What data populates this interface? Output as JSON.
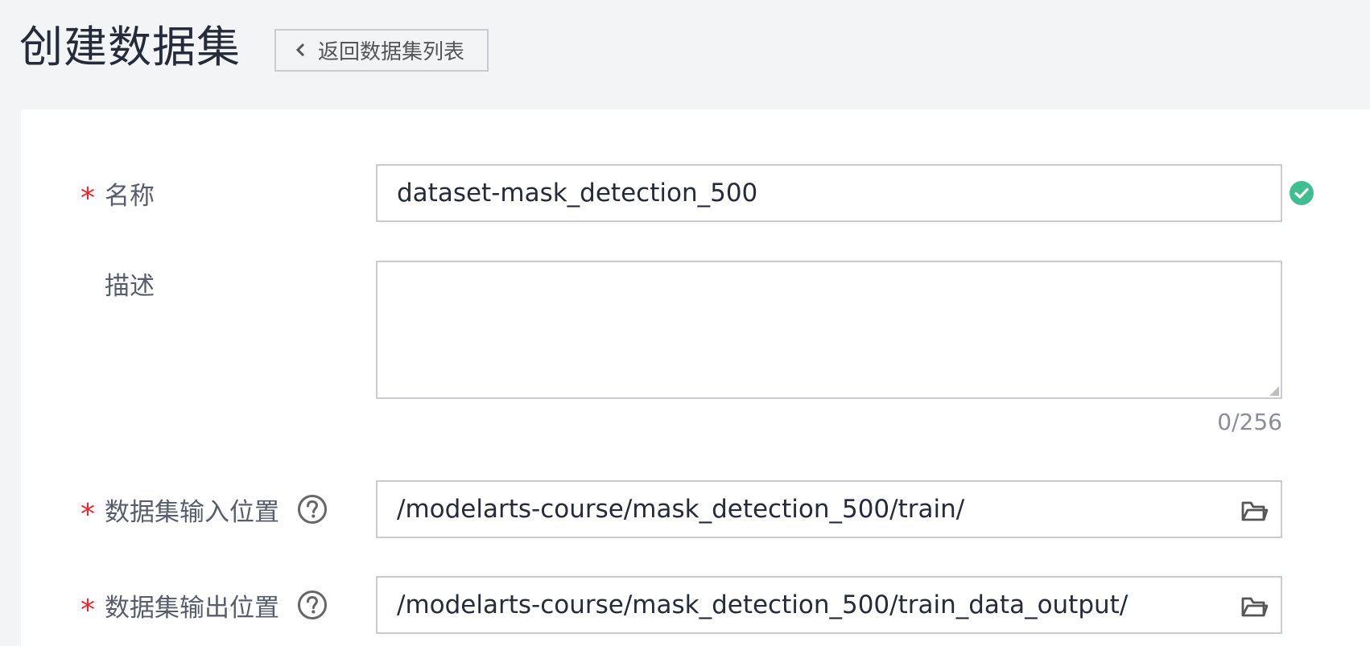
{
  "header": {
    "title": "创建数据集",
    "back_label": "返回数据集列表"
  },
  "form": {
    "name": {
      "required_mark": "*",
      "label": "名称",
      "value": "dataset-mask_detection_500",
      "status_icon": "check-circle-icon"
    },
    "description": {
      "label": "描述",
      "value": "",
      "counter": "0/256"
    },
    "input_location": {
      "required_mark": "*",
      "label": "数据集输入位置",
      "help_icon": "question-circle-icon",
      "value": "/modelarts-course/mask_detection_500/train/",
      "browse_icon": "folder-open-icon"
    },
    "output_location": {
      "required_mark": "*",
      "label": "数据集输出位置",
      "help_icon": "question-circle-icon",
      "value": "/modelarts-course/mask_detection_500/train_data_output/",
      "browse_icon": "folder-open-icon"
    }
  },
  "colors": {
    "required": "#f5222d",
    "success": "#3fbf8f",
    "border": "#c8cbd0",
    "page_bg": "#f3f4f6"
  }
}
